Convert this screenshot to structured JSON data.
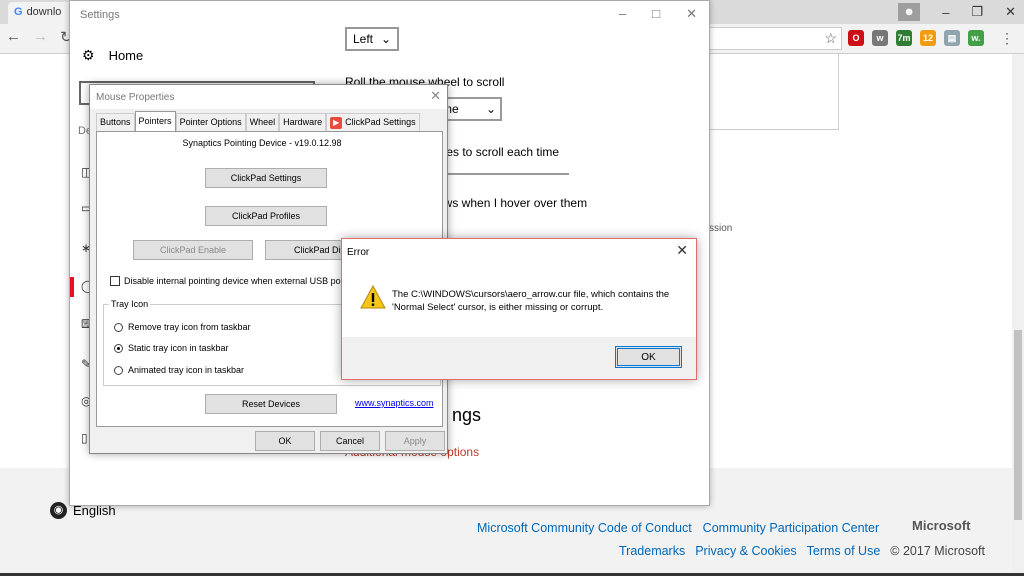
{
  "browser": {
    "tab_title": "downlo",
    "tab_favicon": "G",
    "nav": {
      "back": "←",
      "forward": "→",
      "reload": "↻"
    },
    "extensions": [
      {
        "name": "opera-icon",
        "label": "O",
        "color": "#cc0f16"
      },
      {
        "name": "w-icon",
        "label": "w",
        "color": "#777777"
      },
      {
        "name": "7m-icon",
        "label": "7m",
        "color": "#2e7d32"
      },
      {
        "name": "orange-ext-icon",
        "label": "12",
        "color": "#f39c12"
      },
      {
        "name": "doc-ext-icon",
        "label": "▤",
        "color": "#90a4ae"
      },
      {
        "name": "w-dot-icon",
        "label": "w.",
        "color": "#43a047"
      }
    ]
  },
  "webpage": {
    "text_snippet": "ssion",
    "language": "English",
    "brand": "Microsoft",
    "footer_row1": [
      "Microsoft Community Code of Conduct",
      "Community Participation Center"
    ],
    "footer_row2": [
      "Trademarks",
      "Privacy & Cookies",
      "Terms of Use"
    ],
    "copyright": "© 2017 Microsoft"
  },
  "settings": {
    "title": "Settings",
    "home": "Home",
    "sidebar_letter": "De",
    "primary_button": "Left",
    "scroll_label": "Roll the mouse wheel to scroll",
    "scroll_value": "time",
    "lines_label": "ines to scroll each time",
    "hover_label": "ows when I hover over them",
    "related_heading": "ngs",
    "additional_link": "Additional mouse options"
  },
  "mouse_properties": {
    "title": "Mouse Properties",
    "tabs": [
      "Buttons",
      "Pointers",
      "Pointer Options",
      "Wheel",
      "Hardware",
      "ClickPad Settings"
    ],
    "device": "Synaptics Pointing Device - v19.0.12.98",
    "clickpad_settings_btn": "ClickPad Settings",
    "clickpad_profiles_btn": "ClickPad Profiles",
    "clickpad_enable_btn": "ClickPad Enable",
    "clickpad_disable_btn": "ClickPad Disa",
    "disable_checkbox": "Disable internal pointing device when external USB pointin",
    "tray_group": "Tray Icon",
    "radio_remove": "Remove tray icon from taskbar",
    "radio_static": "Static tray icon in taskbar",
    "radio_animated": "Animated tray icon in taskbar",
    "reset_btn": "Reset Devices",
    "link": "www.synaptics.com",
    "ok": "OK",
    "cancel": "Cancel",
    "apply": "Apply"
  },
  "error": {
    "title": "Error",
    "message": "The C:\\WINDOWS\\cursors\\aero_arrow.cur file, which contains the 'Normal Select' cursor, is either missing or corrupt.",
    "ok": "OK"
  }
}
